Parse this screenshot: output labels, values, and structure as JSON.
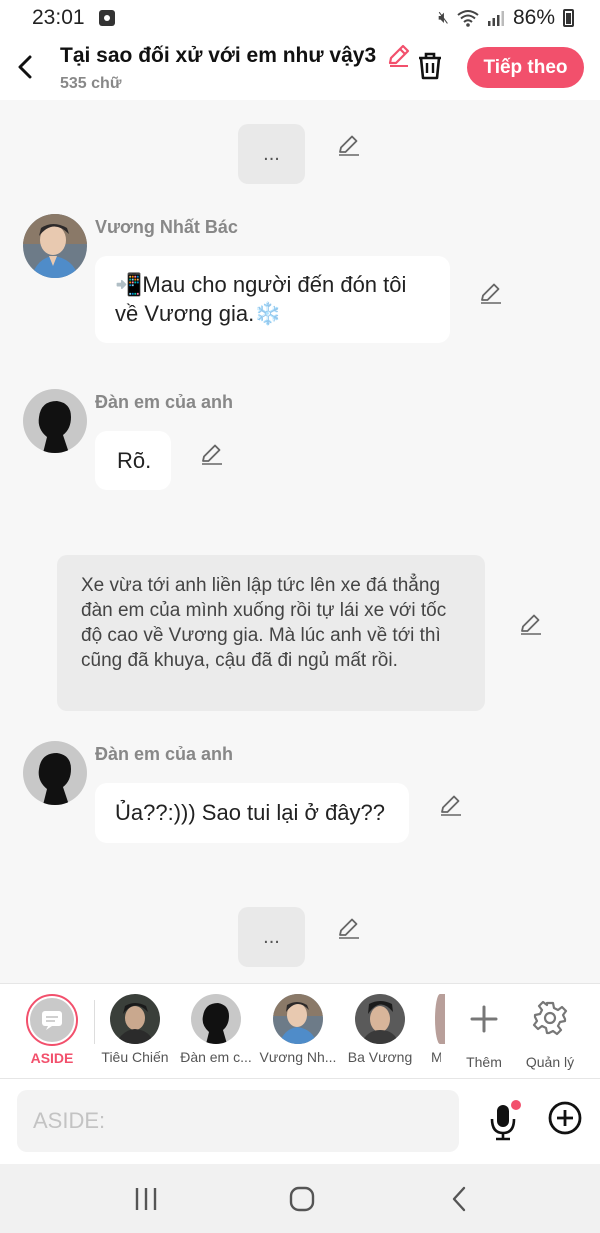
{
  "status": {
    "time": "23:01",
    "battery": "86%"
  },
  "header": {
    "title": "Tại sao đối xử với em như vậy3",
    "word_count": "535 chữ",
    "next_label": "Tiếp theo"
  },
  "chat": {
    "top_placeholder": "...",
    "messages": [
      {
        "sender": "Vương Nhất Bác",
        "text_line1": "📲Mau cho người đến đón tôi",
        "text_line2": "về Vương gia.❄️"
      },
      {
        "sender": "Đàn em của anh",
        "text": "Rõ."
      },
      {
        "type": "narration",
        "text": "Xe vừa tới anh liền lập tức lên xe đá thẳng đàn em của mình xuống rồi tự lái xe với tốc độ cao về Vương gia. Mà lúc anh về tới thì cũng đã khuya, cậu đã đi ngủ mất rồi."
      },
      {
        "sender": "Đàn em của anh",
        "text": "Ủa??:))) Sao tui lại ở đây??"
      }
    ],
    "bottom_placeholder": "..."
  },
  "characters": {
    "aside_label": "ASIDE",
    "items": [
      "Tiêu Chiến",
      "Đàn em c...",
      "Vương Nh...",
      "Ba Vương",
      "M"
    ],
    "add_label": "Thêm",
    "manage_label": "Quản lý"
  },
  "input": {
    "placeholder": "ASIDE:"
  },
  "colors": {
    "accent": "#f2506c",
    "background": "#f7f7f7"
  }
}
